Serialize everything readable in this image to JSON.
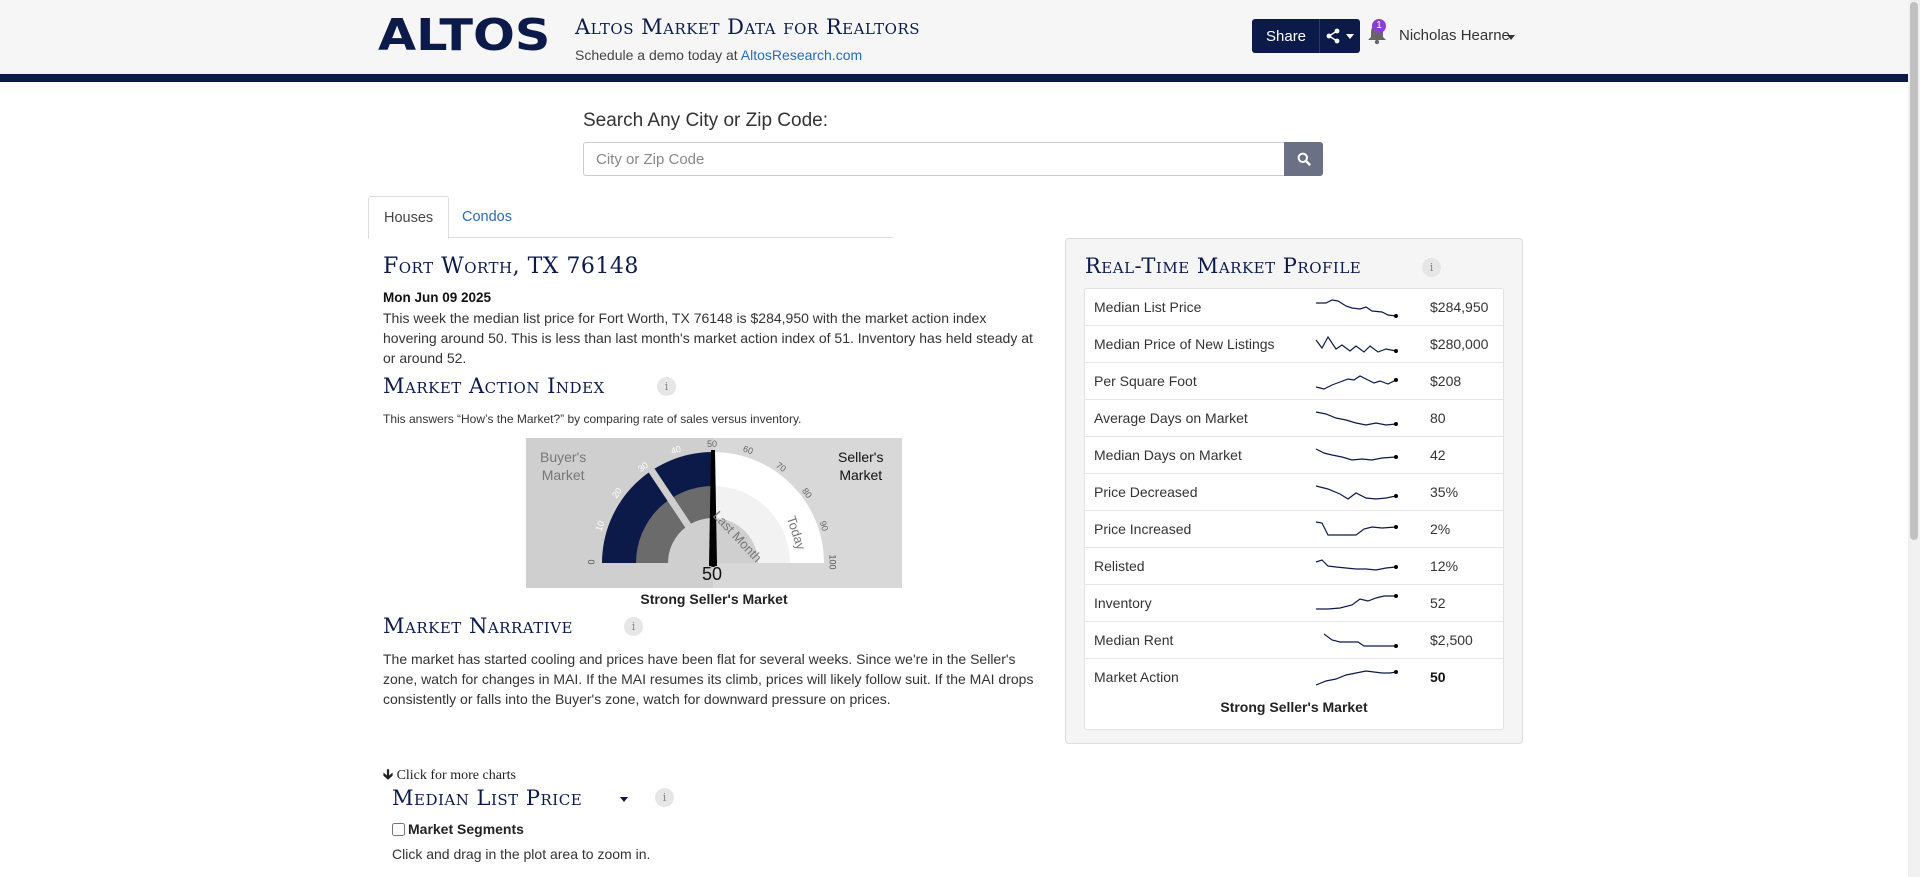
{
  "header": {
    "logo": "ALTOS",
    "title": "Altos Market Data for Realtors",
    "subtitle_prefix": "Schedule a demo today at ",
    "subtitle_link": "AltosResearch.com",
    "share_label": "Share",
    "notification_count": "1",
    "user_name": "Nicholas Hearne",
    "brand_color": "#0c1a4a",
    "link_color": "#2a6ab8"
  },
  "search": {
    "label": "Search Any City or Zip Code:",
    "placeholder": "City or Zip Code",
    "value": ""
  },
  "tabs": [
    {
      "label": "Houses",
      "active": true
    },
    {
      "label": "Condos",
      "active": false
    }
  ],
  "report": {
    "location": "Fort Worth, TX 76148",
    "date": "Mon Jun 09 2025",
    "summary": "This week the median list price for Fort Worth, TX 76148 is $284,950 with the market action index hovering around 50. This is less than last month's market action index of 51. Inventory has held steady at or around 52."
  },
  "mai": {
    "title": "Market Action Index",
    "description": "This answers “How’s the Market?” by comparing rate of sales versus inventory.",
    "buyers_label": [
      "Buyer's",
      "Market"
    ],
    "sellers_label": [
      "Seller's",
      "Market"
    ],
    "last_month_label": "Last Month",
    "today_label": "Today",
    "value": "50",
    "scale_ticks": [
      "0",
      "10",
      "20",
      "30",
      "40",
      "50",
      "60",
      "70",
      "80",
      "90",
      "100"
    ],
    "caption": "Strong Seller's Market"
  },
  "narrative": {
    "title": "Market Narrative",
    "text": "The market has started cooling and prices have been flat for several weeks. Since we're in the Seller's zone, watch for changes in MAI. If the MAI resumes its climb, prices will likely follow suit. If the MAI drops consistently or falls into the Buyer's zone, watch for downward pressure on prices."
  },
  "more_charts": {
    "link": "Click for more charts",
    "chart_title": "Median List Price",
    "segments_label": "Market Segments",
    "segments_checked": false,
    "drag_note": "Click and drag in the plot area to zoom in."
  },
  "profile": {
    "title": "Real-Time Market Profile",
    "rows": [
      {
        "label": "Median List Price",
        "value": "$284,950"
      },
      {
        "label": "Median Price of New Listings",
        "value": "$280,000"
      },
      {
        "label": "Per Square Foot",
        "value": "$208"
      },
      {
        "label": "Average Days on Market",
        "value": "80"
      },
      {
        "label": "Median Days on Market",
        "value": "42"
      },
      {
        "label": "Price Decreased",
        "value": "35%"
      },
      {
        "label": "Price Increased",
        "value": "2%"
      },
      {
        "label": "Relisted",
        "value": "12%"
      },
      {
        "label": "Inventory",
        "value": "52"
      },
      {
        "label": "Median Rent",
        "value": "$2,500"
      },
      {
        "label": "Market Action",
        "value": "50"
      }
    ],
    "footer": "Strong Seller's Market"
  }
}
